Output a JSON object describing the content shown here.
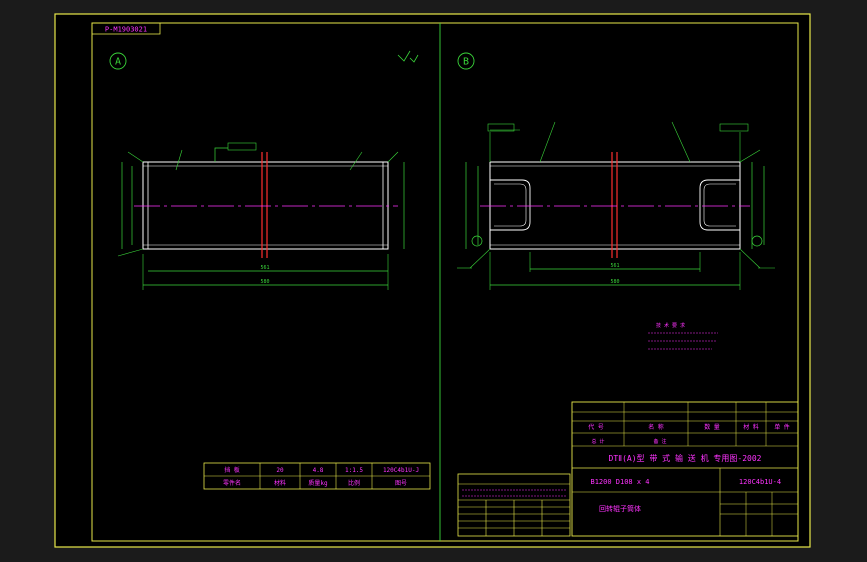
{
  "drawing_number": "P-M1903021",
  "view_a_label": "A",
  "view_b_label": "B",
  "dim_overall_a": "580",
  "dim_inner_a": "561",
  "dim_overall_b": "580",
  "dim_inner_b": "561",
  "tech_notes_title": "技 术 要 求",
  "parts_table": {
    "row1": [
      "挡 板",
      "20",
      "4.8",
      "1:1.5",
      "120C4b1U-J"
    ],
    "row2": [
      "零件名",
      "材料",
      "质量kg",
      "比例",
      "图号"
    ]
  },
  "title_block": {
    "main_title": "DTⅡ(A)型  带 式 输 送 机 专用图-2002",
    "spec": "B1200  D108 x 4",
    "drawing_code": "120C4b1U-4",
    "part_name": "回转辊子筒体",
    "sig_labels": [
      "代  号",
      "名  称",
      "数  量",
      "材  料",
      "单 件",
      "总 计",
      "备 注"
    ]
  },
  "colors": {
    "border": "#e8e84a",
    "outline": "#ffffff",
    "center": "#ff33ff",
    "dim": "#3ad63a",
    "hatch": "#ff3030"
  }
}
